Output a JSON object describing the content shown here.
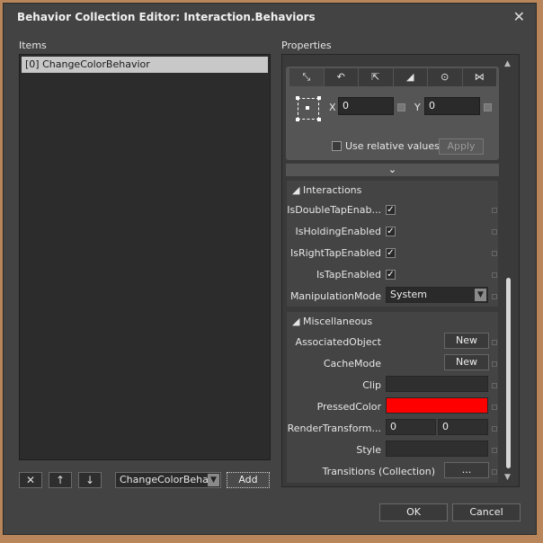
{
  "dialog": {
    "title": "Behavior Collection Editor: Interaction.Behaviors",
    "close_glyph": "✕"
  },
  "items": {
    "label": "Items",
    "list": [
      "[0] ChangeColorBehavior"
    ],
    "buttons": {
      "remove": "✕",
      "up": "↑",
      "down": "↓"
    },
    "combo_value": "ChangeColorBeha",
    "add_label": "Add"
  },
  "properties": {
    "label": "Properties",
    "transform": {
      "tab_icons": [
        "move-icon",
        "rotate-icon",
        "scale-icon",
        "skew-icon",
        "center-point-icon",
        "flip-icon"
      ],
      "tab_glyphs": [
        "⤡",
        "↶",
        "⇱",
        "◢",
        "⊙",
        "⋈"
      ],
      "x_label": "X",
      "x_value": "0",
      "y_label": "Y",
      "y_value": "0",
      "relative_label": "Use relative values",
      "apply_label": "Apply"
    },
    "expand_glyph": "⌄",
    "interactions": {
      "header": "Interactions",
      "rows": [
        {
          "label": "IsDoubleTapEnab...",
          "checked": true
        },
        {
          "label": "IsHoldingEnabled",
          "checked": true
        },
        {
          "label": "IsRightTapEnabled",
          "checked": true
        },
        {
          "label": "IsTapEnabled",
          "checked": true
        }
      ],
      "manipulation_label": "ManipulationMode",
      "manipulation_value": "System"
    },
    "misc": {
      "header": "Miscellaneous",
      "associated_label": "AssociatedObject",
      "cache_label": "CacheMode",
      "new_label": "New",
      "clip_label": "Clip",
      "pressed_label": "PressedColor",
      "pressed_color": "#ff0000",
      "render_label": "RenderTransform...",
      "render_x": "0",
      "render_y": "0",
      "style_label": "Style",
      "transitions_label": "Transitions",
      "transitions_value": "(Collection)",
      "ellipsis": "..."
    }
  },
  "footer": {
    "ok": "OK",
    "cancel": "Cancel"
  }
}
